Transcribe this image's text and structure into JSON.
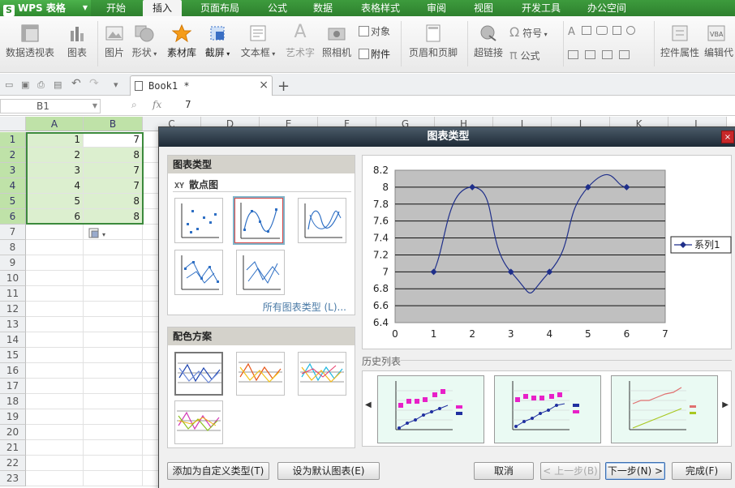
{
  "app": {
    "logo_text": "WPS 表格",
    "logo_letter": "S"
  },
  "menu": {
    "tabs": [
      "开始",
      "插入",
      "页面布局",
      "公式",
      "数据",
      "表格样式",
      "审阅",
      "视图",
      "开发工具",
      "办公空间"
    ],
    "active": "插入"
  },
  "ribbon": {
    "pivot": "数据透视表",
    "chart": "图表",
    "picture": "图片",
    "shape": "形状",
    "material": "素材库",
    "screenshot": "截屏",
    "textbox": "文本框",
    "arttext": "艺术字",
    "camera": "照相机",
    "object": "对象",
    "attachment": "附件",
    "header_footer": "页眉和页脚",
    "hyperlink": "超链接",
    "symbol": "符号",
    "formula": "公式",
    "control_props": "控件属性",
    "edit_code": "编辑代"
  },
  "doc_tab": {
    "label": "Book1 *",
    "close": "×",
    "add": "+"
  },
  "formula_bar": {
    "cell_ref": "B1",
    "fx": "fx",
    "value": "7"
  },
  "grid": {
    "columns": [
      "A",
      "B",
      "C",
      "D",
      "E",
      "F",
      "G",
      "H",
      "I",
      "J",
      "K",
      "L"
    ],
    "rows": [
      "1",
      "2",
      "3",
      "4",
      "5",
      "6",
      "7",
      "8",
      "9",
      "10",
      "11",
      "12",
      "13",
      "14",
      "15",
      "16",
      "17",
      "18",
      "19",
      "20",
      "21",
      "22",
      "23"
    ],
    "data": [
      [
        "1",
        "7"
      ],
      [
        "2",
        "8"
      ],
      [
        "3",
        "7"
      ],
      [
        "4",
        "7"
      ],
      [
        "5",
        "8"
      ],
      [
        "6",
        "8"
      ]
    ]
  },
  "dialog": {
    "title": "图表类型",
    "close": "×",
    "chart_type_header": "图表类型",
    "scatter_label_prefix": "XY",
    "scatter_label": "散点图",
    "all_types_link": "所有图表类型 (L)...",
    "color_scheme_header": "配色方案",
    "history_label": "历史列表",
    "buttons": {
      "add_custom": "添加为自定义类型(T)",
      "set_default": "设为默认图表(E)",
      "cancel": "取消",
      "prev": "< 上一步(B)",
      "next": "下一步(N) >",
      "finish": "完成(F)"
    }
  },
  "chart_data": {
    "type": "scatter",
    "subtype": "smooth-line-with-markers",
    "x": [
      1,
      2,
      3,
      4,
      5,
      6
    ],
    "series": [
      {
        "name": "系列1",
        "values": [
          7,
          8,
          7,
          7,
          8,
          8
        ]
      }
    ],
    "xlim": [
      0,
      7
    ],
    "ylim": [
      6.4,
      8.2
    ],
    "xticks": [
      "0",
      "1",
      "2",
      "3",
      "4",
      "5",
      "6",
      "7"
    ],
    "yticks": [
      "6.4",
      "6.6",
      "6.8",
      "7",
      "7.2",
      "7.4",
      "7.6",
      "7.8",
      "8",
      "8.2"
    ],
    "plot_bg": "#c0c0c0",
    "line_color": "#1f2f8a",
    "grid": true,
    "legend": "right"
  }
}
